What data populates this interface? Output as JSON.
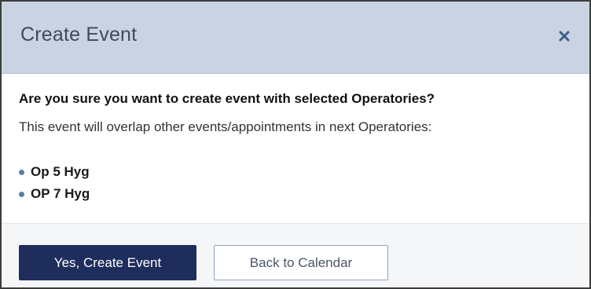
{
  "dialog": {
    "title": "Create Event",
    "close_icon": "close-icon",
    "question": "Are you sure you want to create event with selected Operatories?",
    "description": "This event will overlap other events/appointments in next Operatories:",
    "operatories": [
      {
        "label": "Op 5 Hyg"
      },
      {
        "label": "OP 7 Hyg"
      }
    ],
    "buttons": {
      "confirm_label": "Yes, Create Event",
      "back_label": "Back to Calendar"
    }
  },
  "colors": {
    "header_bg": "#c9d3e2",
    "primary_button": "#1e2d5c",
    "close_icon": "#3e5f8a",
    "bullet": "#5b7fa6"
  }
}
